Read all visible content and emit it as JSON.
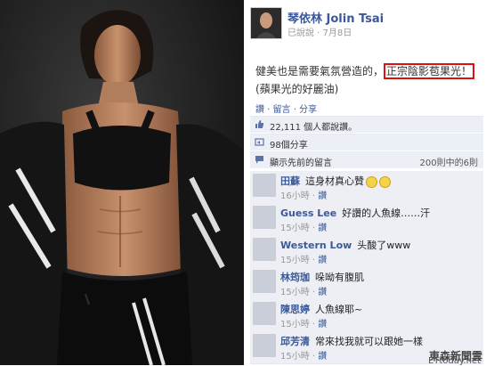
{
  "post": {
    "author": "琴依林 Jolin Tsai",
    "meta_said": "已說說",
    "meta_date": "7月8日",
    "text_before": "健美也是需要氣氛營造的，",
    "text_highlight": "正宗陰影苞果光！",
    "text_after": "(蘋果光的好麗油)",
    "actions": "讚 · 留言 · 分享"
  },
  "likes": "22,111 個人都說讚。",
  "shares": "98個分享",
  "prev_comments": "顯示先前的留言",
  "comment_count": "200則中的6則",
  "comments": [
    {
      "name": "田蘇",
      "text": "這身材真心贊",
      "time": "16小時",
      "like": "讚"
    },
    {
      "name": "Guess Lee",
      "text": "好讚的人魚線……汗",
      "time": "15小時",
      "like": "讚"
    },
    {
      "name": "Western Low",
      "text": "头酸了www",
      "time": "15小時",
      "like": "讚"
    },
    {
      "name": "林筠珈",
      "text": "哚呦有腹肌",
      "time": "15小時",
      "like": "讚"
    },
    {
      "name": "陳思婷",
      "text": "人魚線耶~",
      "time": "15小時",
      "like": "讚"
    },
    {
      "name": "邱芳清",
      "text": "常來找我就可以跟她一樣",
      "time": "15小時",
      "like": "讚"
    }
  ],
  "watermark": "東森新聞雲",
  "watermark_sub": "ETtoday.net",
  "colors": {
    "fb_blue": "#3b5998",
    "highlight_border": "#dd1111",
    "comment_bg": "#edeff4"
  }
}
